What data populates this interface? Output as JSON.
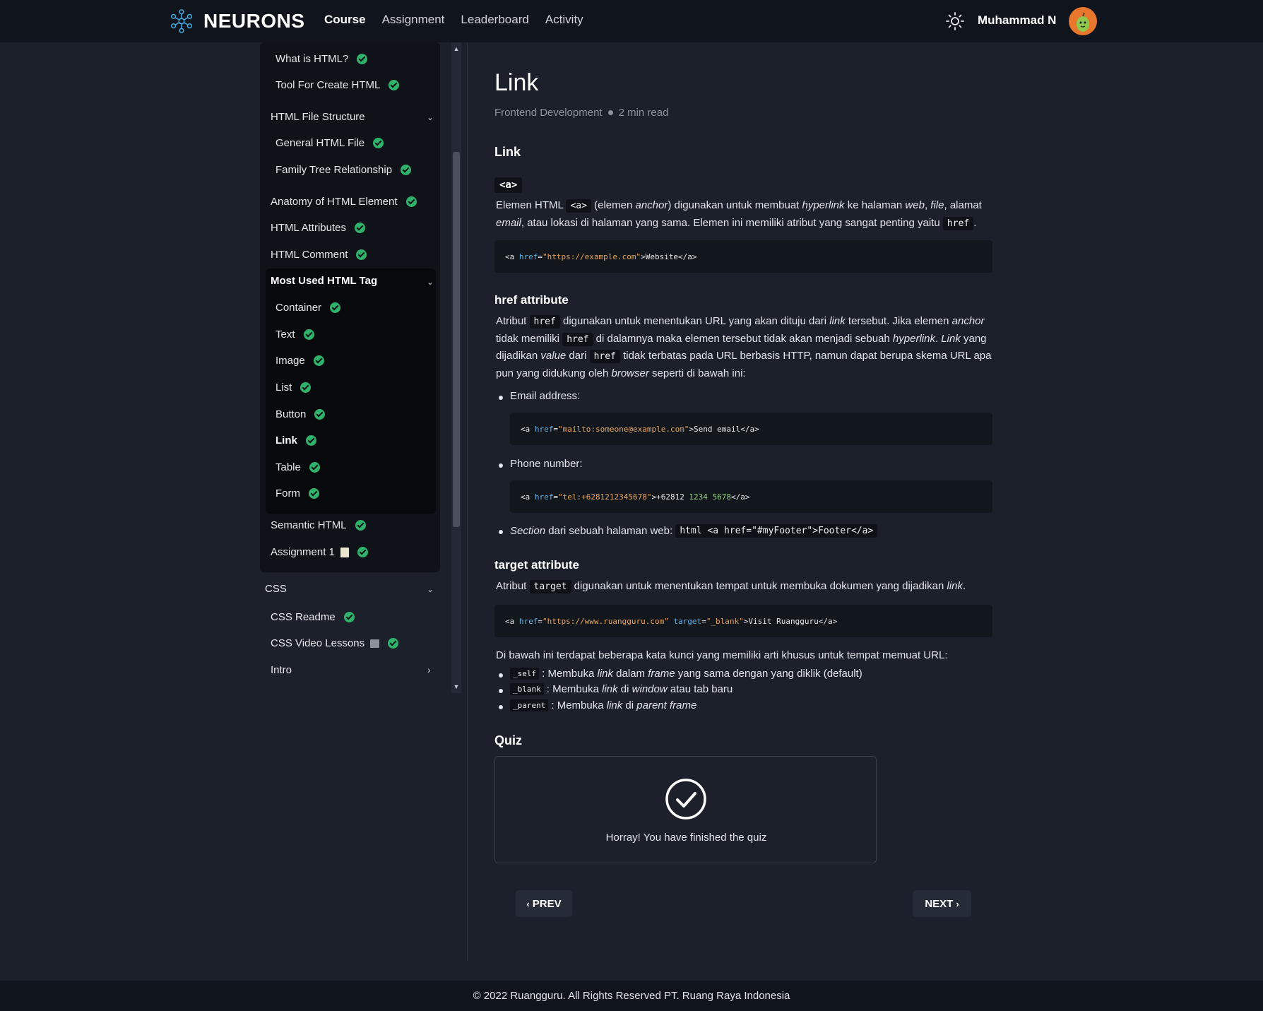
{
  "navbar": {
    "brand": "NEURONS",
    "links": [
      "Course",
      "Assignment",
      "Leaderboard",
      "Activity"
    ],
    "active_link": "Course",
    "username": "Muhammad N"
  },
  "sidebar": {
    "items": [
      {
        "label": "What is HTML?",
        "done": true
      },
      {
        "label": "Tool For Create HTML",
        "done": true
      },
      {
        "label": "HTML File Structure",
        "expanded": true
      },
      {
        "label": "General HTML File",
        "done": true
      },
      {
        "label": "Family Tree Relationship",
        "done": true
      },
      {
        "label": "Anatomy of HTML Element",
        "done": true
      },
      {
        "label": "HTML Attributes",
        "done": true
      },
      {
        "label": "HTML Comment",
        "done": true
      },
      {
        "label": "Most Used HTML Tag",
        "expanded": true
      },
      {
        "label": "Container",
        "done": true
      },
      {
        "label": "Text",
        "done": true
      },
      {
        "label": "Image",
        "done": true
      },
      {
        "label": "List",
        "done": true
      },
      {
        "label": "Button",
        "done": true
      },
      {
        "label": "Link",
        "done": true,
        "active": true
      },
      {
        "label": "Table",
        "done": true
      },
      {
        "label": "Form",
        "done": true
      },
      {
        "label": "Semantic HTML",
        "done": true
      },
      {
        "label": "Assignment 1",
        "done": true,
        "icon": "document-icon"
      },
      {
        "label": "CSS",
        "expanded": true
      },
      {
        "label": "CSS Readme",
        "done": true
      },
      {
        "label": "CSS Video Lessons",
        "done": true,
        "icon": "film-icon"
      },
      {
        "label": "Intro",
        "collapsed": true
      }
    ]
  },
  "article": {
    "title": "Link",
    "category": "Frontend Development",
    "read_time": "2 min read",
    "section1_heading": "Link",
    "tag": "<a>",
    "p1": {
      "a": "Elemen HTML ",
      "code1": "<a>",
      "b": " (elemen ",
      "i1": "anchor",
      "c": ") digunakan untuk membuat ",
      "i2": "hyperlink",
      "d": " ke halaman ",
      "i3": "web",
      "e": ", ",
      "i4": "file",
      "f": ", alamat ",
      "i5": "email",
      "g": ", atau lokasi di halaman yang sama. Elemen ini memiliki atribut yang sangat penting yaitu ",
      "code2": "href",
      "h": "."
    },
    "code1": {
      "open": "<a ",
      "attr": "href",
      "eq": "=",
      "val": "\"https://example.com\"",
      "rest": ">Website</a>"
    },
    "section2_heading": "href attribute",
    "p2": {
      "a": "Atribut ",
      "code1": "href",
      "b": " digunakan untuk menentukan URL yang akan dituju dari ",
      "i1": "link",
      "c": " tersebut. Jika elemen ",
      "i2": "anchor",
      "d": " tidak memiliki ",
      "code2": "href",
      "e": " di dalamnya maka elemen tersebut tidak akan menjadi sebuah ",
      "i3": "hyperlink",
      "f": ". ",
      "i4": "Link",
      "g": " yang dijadikan ",
      "i5": "value",
      "h": " dari ",
      "code3": "href",
      "i": " tidak terbatas pada URL berbasis HTTP, namun dapat berupa skema URL apa pun yang didukung oleh ",
      "i6": "browser",
      "j": " seperti di bawah ini:"
    },
    "bullet_email": "Email address:",
    "code_email": {
      "open": "<a ",
      "attr": "href",
      "eq": "=",
      "val": "\"mailto:someone@example.com\"",
      "rest": ">Send email</a>"
    },
    "bullet_phone": "Phone number:",
    "code_phone": {
      "open": "<a ",
      "attr": "href",
      "eq": "=",
      "val": "\"tel:+6281212345678\"",
      "mid": ">+62812 ",
      "n1": "1234",
      "sp": " ",
      "n2": "5678",
      "rest": "</a>"
    },
    "bullet_section": {
      "i": "Section",
      "a": " dari sebuah halaman web: ",
      "code": "html <a href=\"#myFooter\">Footer</a>"
    },
    "section3_heading": "target attribute",
    "p3": {
      "a": "Atribut ",
      "code": "target",
      "b": " digunakan untuk menentukan tempat untuk membuka dokumen yang dijadikan ",
      "i": "link",
      "c": "."
    },
    "code_target": {
      "open": "<a ",
      "attr1": "href",
      "eq1": "=",
      "val1": "\"https://www.ruangguru.com\"",
      "sp": " ",
      "attr2": "target",
      "eq2": "=",
      "val2": "\"_blank\"",
      "rest": ">Visit Ruangguru</a>"
    },
    "p4": "Di bawah ini terdapat beberapa kata kunci yang memiliki arti khusus untuk tempat memuat URL:",
    "targets": [
      {
        "code": "_self",
        "a": ": Membuka ",
        "i1": "link",
        "b": " dalam ",
        "i2": "frame",
        "c": " yang sama dengan yang diklik (default)"
      },
      {
        "code": "_blank",
        "a": ": Membuka ",
        "i1": "link",
        "b": " di ",
        "i2": "window",
        "c": " atau tab baru"
      },
      {
        "code": "_parent",
        "a": ": Membuka ",
        "i1": "link",
        "b": " di ",
        "i2": "parent frame",
        "c": ""
      }
    ],
    "quiz_heading": "Quiz",
    "quiz_message": "Horray! You have finished the quiz",
    "prev_label": "PREV",
    "next_label": "NEXT"
  },
  "footer": {
    "text": "© 2022 Ruangguru. All Rights Reserved PT. Ruang Raya Indonesia"
  },
  "colors": {
    "accent_check": "#2fb36b",
    "background": "#1b202b",
    "navbar": "#10141c"
  }
}
